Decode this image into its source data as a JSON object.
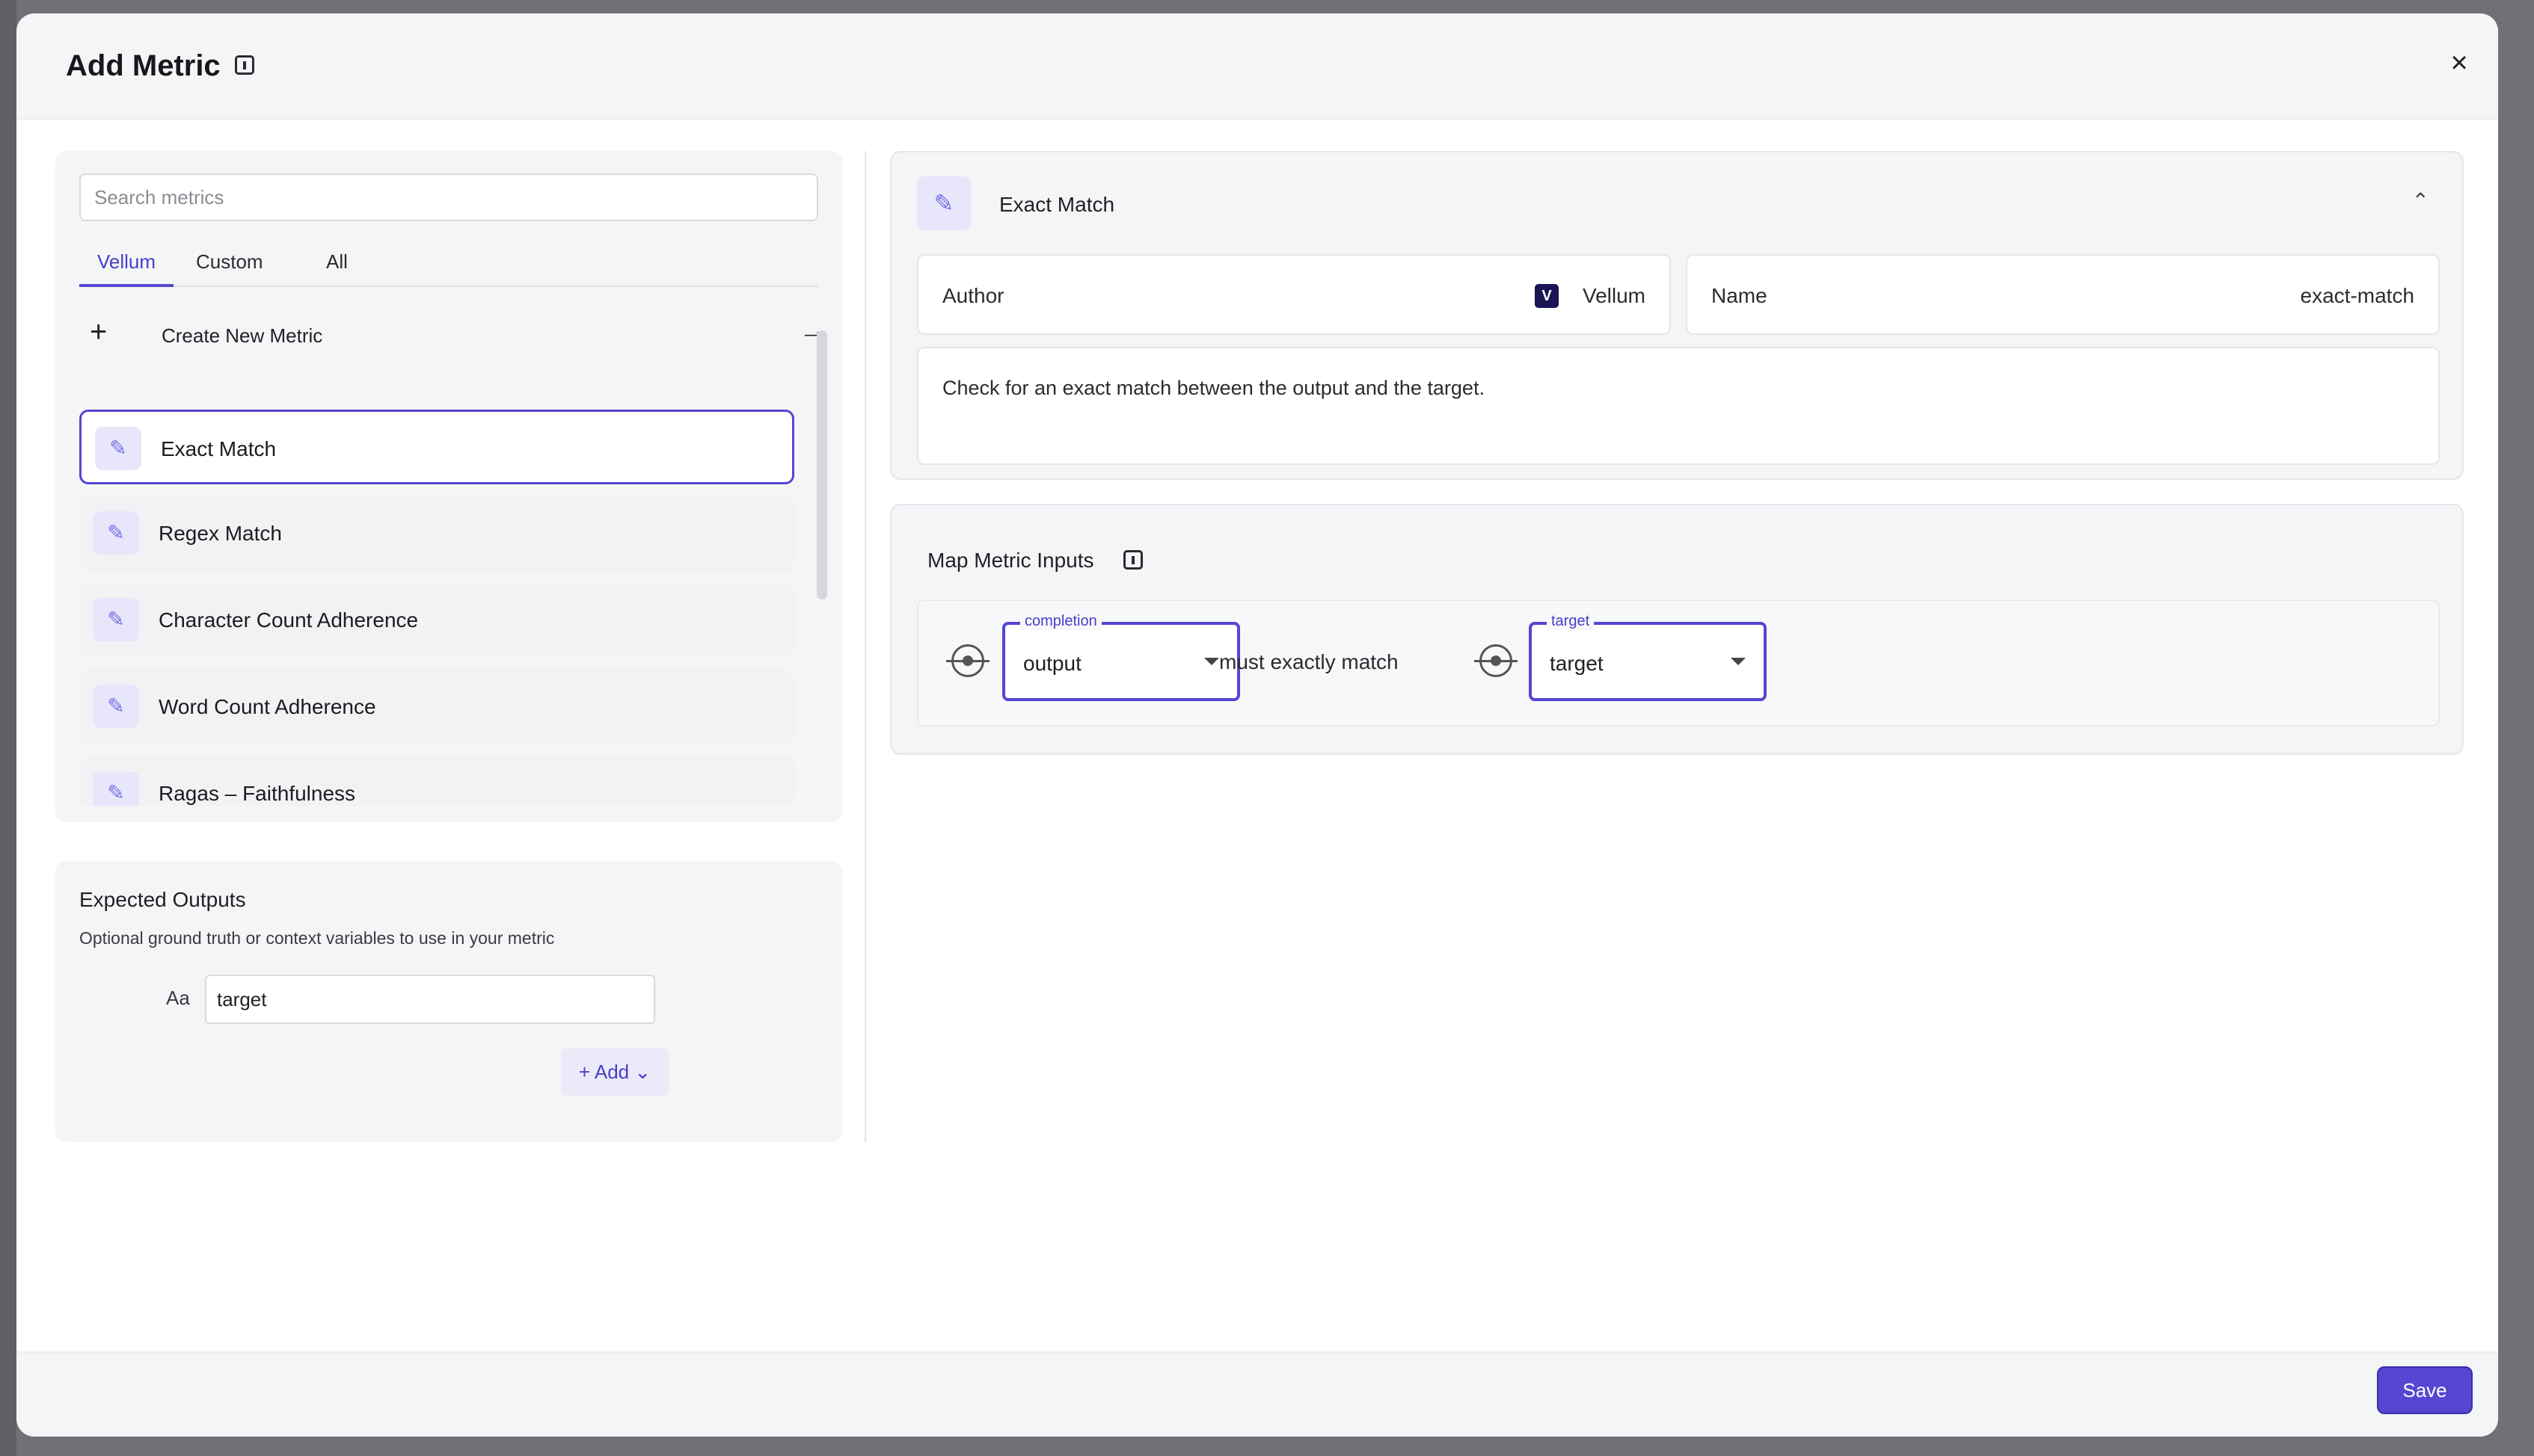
{
  "modal": {
    "title": "Add Metric",
    "close_glyph": "×",
    "save_label": "Save"
  },
  "search": {
    "placeholder": "Search metrics"
  },
  "tabs": [
    {
      "label": "Vellum",
      "active": true
    },
    {
      "label": "Custom",
      "active": false
    },
    {
      "label": "All",
      "active": false
    }
  ],
  "create": {
    "label": "Create New Metric",
    "plus_glyph": "+",
    "arrow_glyph": "→"
  },
  "metrics": [
    {
      "label": "Exact Match",
      "selected": true
    },
    {
      "label": "Regex Match",
      "selected": false
    },
    {
      "label": "Character Count Adherence",
      "selected": false
    },
    {
      "label": "Word Count Adherence",
      "selected": false
    },
    {
      "label": "Ragas – Faithfulness",
      "selected": false
    }
  ],
  "expected_outputs": {
    "title": "Expected Outputs",
    "description": "Optional ground truth or context variables to use in your metric",
    "type_glyph": "Aa",
    "variable_value": "target",
    "add_label": "+ Add ⌄"
  },
  "detail": {
    "title": "Exact Match",
    "author_label": "Author",
    "author_badge": "V",
    "author_value": "Vellum",
    "name_label": "Name",
    "name_value": "exact-match",
    "description": "Check for an exact match between the output and the target.",
    "collapse_glyph": "⌃"
  },
  "map_inputs": {
    "title": "Map Metric Inputs",
    "left_select": {
      "legend": "completion",
      "value": "output"
    },
    "connector_text": "must exactly match",
    "right_select": {
      "legend": "target",
      "value": "target"
    }
  },
  "icons": {
    "metric": "ruler-icon",
    "info": "info-icon",
    "target": "crosshair-icon"
  },
  "colors": {
    "accent": "#5646d1",
    "panel": "#f4f5f7"
  }
}
